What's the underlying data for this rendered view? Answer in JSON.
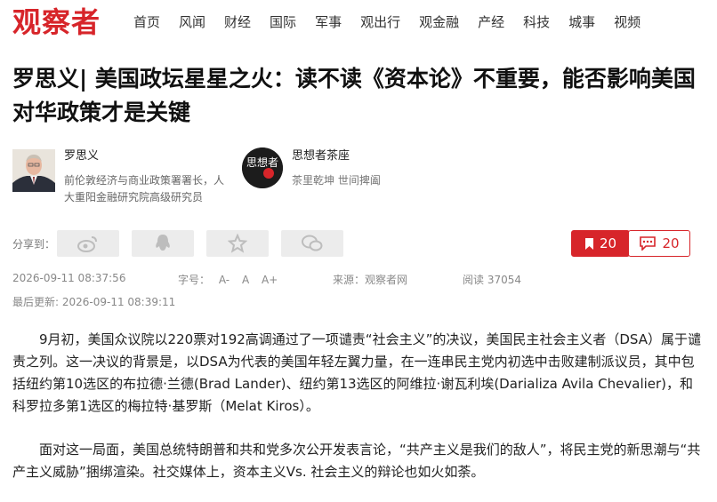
{
  "site": {
    "logo_text": "观察者",
    "brand_color": "#d7252a"
  },
  "nav": {
    "items": [
      "首页",
      "风闻",
      "财经",
      "国际",
      "军事",
      "观出行",
      "观金融",
      "产经",
      "科技",
      "城事",
      "视频"
    ]
  },
  "article": {
    "headline": "罗思义| 美国政坛星星之火：读不读《资本论》不重要，能否影响美国对华政策才是关键",
    "paragraphs": [
      "9月初，美国众议院以220票对192高调通过了一项谴责“社会主义”的决议，美国民主社会主义者（DSA）属于谴责之列。这一决议的背景是，以DSA为代表的美国年轻左翼力量，在一连串民主党内初选中击败建制派议员，其中包括纽约第10选区的布拉德·兰德(Brad Lander)、纽约第13选区的阿维拉·谢瓦利埃(Darializa Avila Chevalier)，和科罗拉多第1选区的梅拉特·基罗斯（Melat Kiros）。",
      "面对这一局面，美国总统特朗普和共和党多次公开发表言论，“共产主义是我们的敌人”，将民主党的新思潮与“共产主义威胁”捆绑渲染。社交媒体上，资本主义Vs. 社会主义的辩论也如火如荼。"
    ]
  },
  "author": {
    "name": "罗思义",
    "description": "前伦敦经济与商业政策署署长，人大重阳金融研究院高级研究员"
  },
  "column": {
    "name": "思想者茶座",
    "subtitle": "茶里乾坤 世间捭阖",
    "logo_text": "思想者"
  },
  "share": {
    "label": "分享到：",
    "icons": [
      "weibo-icon",
      "qq-icon",
      "qzone-star-icon",
      "wechat-icon"
    ],
    "favorite_count": "20",
    "comment_count": "20"
  },
  "meta": {
    "publish_time": "2026-09-11 08:37:56",
    "font_size_label": "字号：",
    "font_size_options": [
      "A-",
      "A",
      "A+"
    ],
    "source_label": "来源：观察者网",
    "views_label": "阅读 37054",
    "updated_label": "最后更新: 2026-09-11 08:39:11"
  }
}
